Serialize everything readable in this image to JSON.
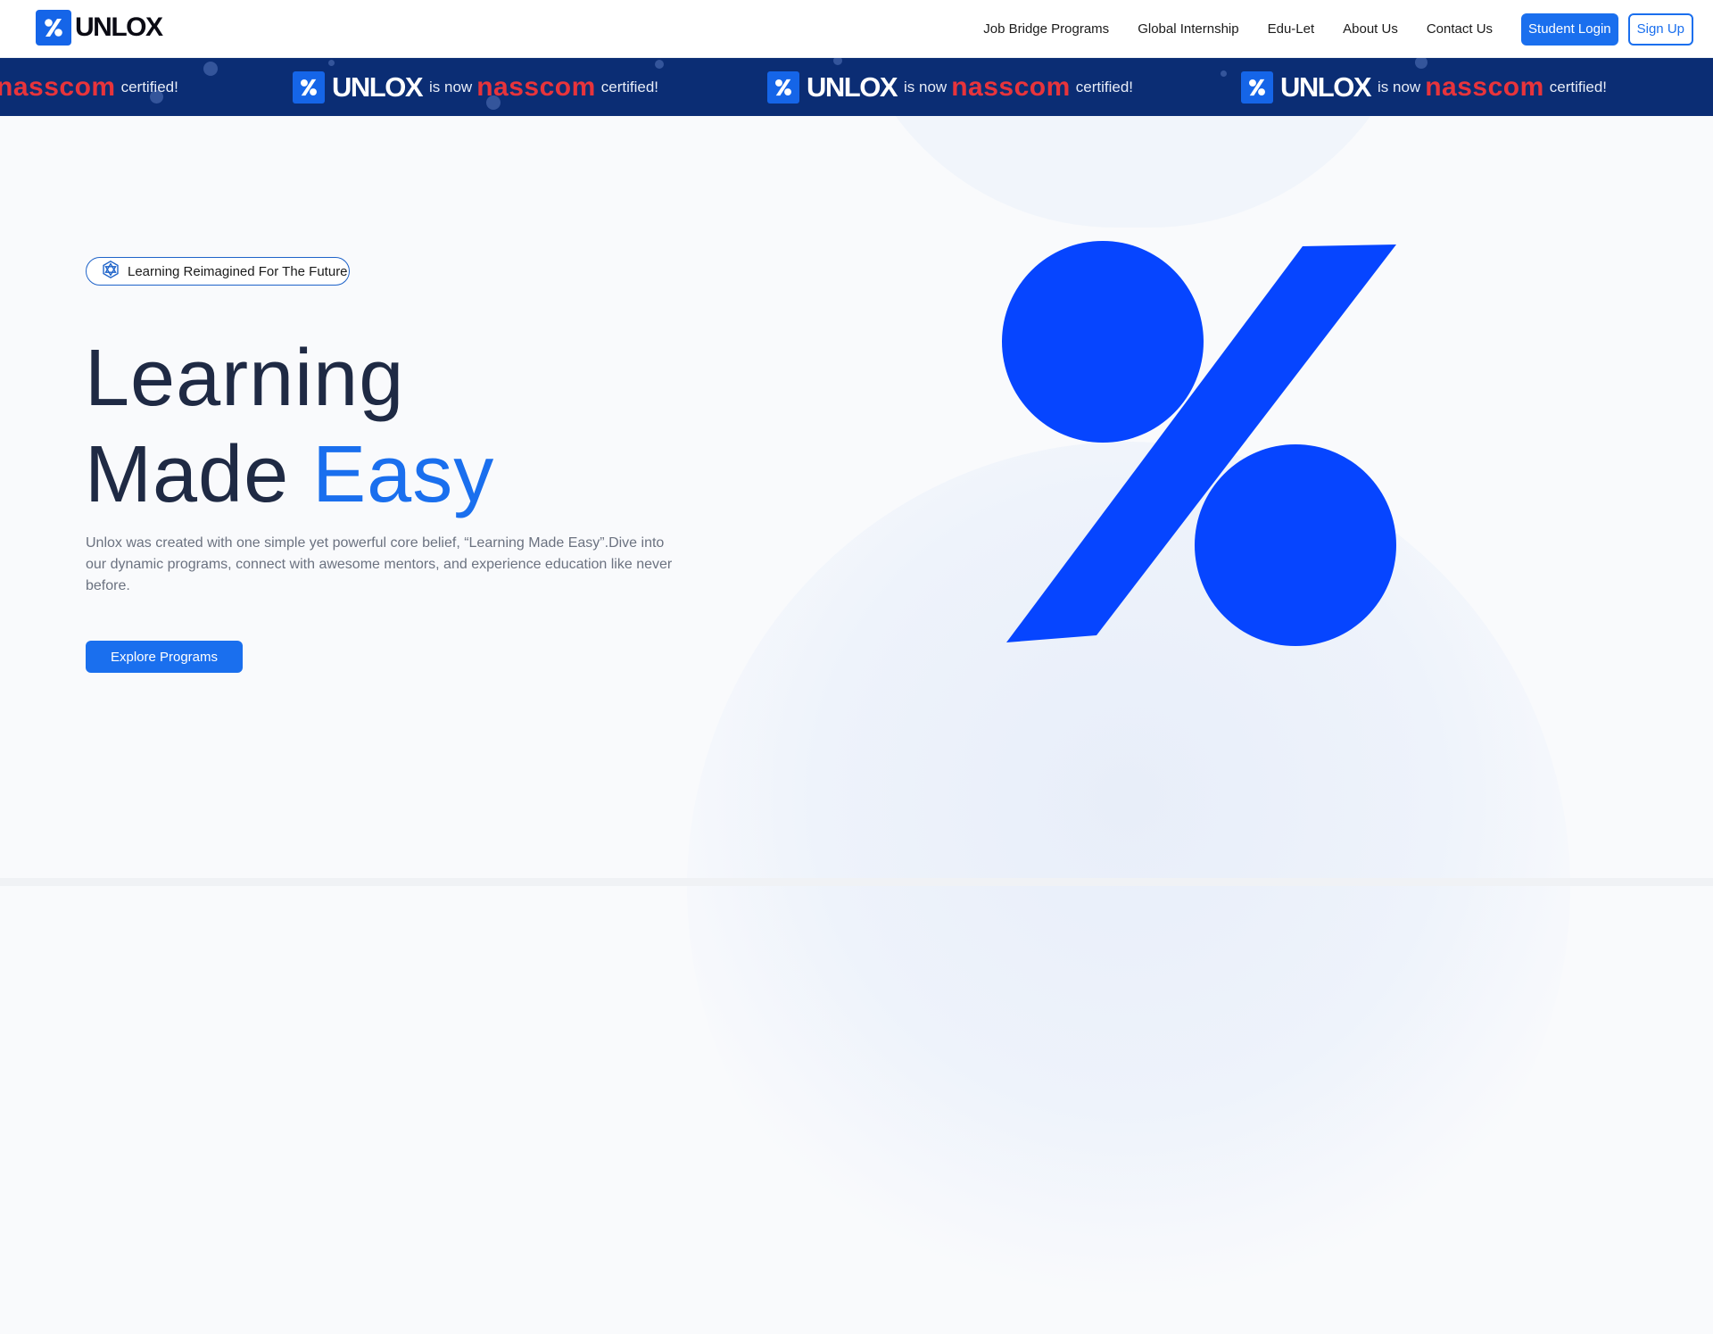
{
  "header": {
    "brand": "UNLOX",
    "nav": [
      "Job Bridge Programs",
      "Global Internship",
      "Edu-Let",
      "About Us",
      "Contact Us"
    ],
    "login_label": "Student Login",
    "signup_label": "Sign Up"
  },
  "banner": {
    "brand": "UNLOX",
    "is_now": "is now",
    "partner": "nasscom",
    "certified": "certified!"
  },
  "hero": {
    "tag": "Learning Reimagined For The Future",
    "headline_line1": "Learning",
    "headline_line2a": "Made",
    "headline_line2b": "Easy",
    "description": "Unlox was created with one simple yet powerful core belief, “Learning Made Easy”.Dive into our dynamic programs, connect with awesome mentors, and experience education like never before.",
    "cta": "Explore Programs"
  },
  "colors": {
    "primary": "#1a6fee",
    "banner_bg": "#0b2d74",
    "partner_red": "#e8343b",
    "logo_blue": "#0645ff",
    "heading": "#1f2a44"
  },
  "icons": {
    "brand_logo": "percent-icon",
    "tag_icon": "hexagram-icon"
  }
}
